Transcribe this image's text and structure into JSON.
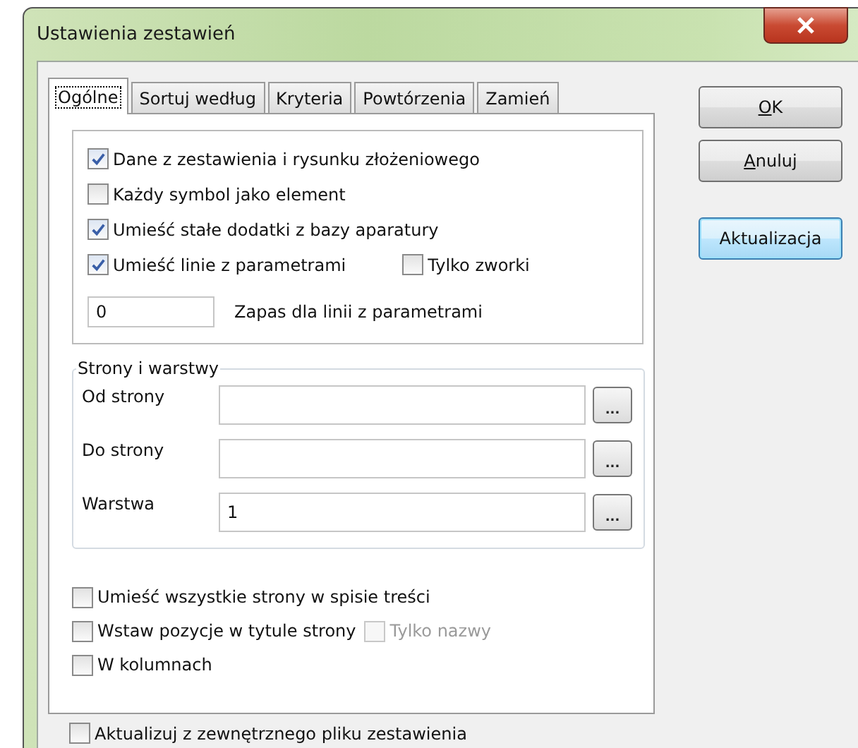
{
  "window": {
    "title": "Ustawienia zestawień"
  },
  "tabs": [
    {
      "label": "Ogólne",
      "selected": true
    },
    {
      "label": "Sortuj według",
      "selected": false
    },
    {
      "label": "Kryteria",
      "selected": false
    },
    {
      "label": "Powtórzenia",
      "selected": false
    },
    {
      "label": "Zamień",
      "selected": false
    }
  ],
  "options": [
    {
      "label": "Dane z zestawienia i rysunku złożeniowego",
      "checked": true
    },
    {
      "label": "Każdy symbol jako element",
      "checked": false
    },
    {
      "label": "Umieść stałe dodatki z bazy aparatury",
      "checked": true
    },
    {
      "label": "Umieść linie z parametrami",
      "checked": true,
      "extra": {
        "label": "Tylko zworki",
        "checked": false,
        "disabled": false
      }
    }
  ],
  "reserve": {
    "value": "0",
    "label": "Zapas dla linii z parametrami"
  },
  "pages_group": {
    "title": "Strony i warstwy",
    "fields": [
      {
        "label": "Od strony",
        "button": "..."
      },
      {
        "label": "Do strony",
        "button": "..."
      },
      {
        "label": "Warstwa",
        "value": "1",
        "button": "..."
      }
    ]
  },
  "page_options": [
    {
      "label": "Umieść wszystkie strony w spisie treści",
      "checked": false
    },
    {
      "label": "Wstaw pozycje w tytule strony",
      "checked": false,
      "extra": {
        "label": "Tylko nazwy",
        "checked": false,
        "disabled": true
      }
    },
    {
      "label": "W kolumnach",
      "checked": false
    }
  ],
  "bottom_option": {
    "label": "Aktualizuj z zewnętrznego pliku zestawienia",
    "checked": false
  },
  "buttons": [
    {
      "label": "OK",
      "mnemonic": true,
      "focused": false
    },
    {
      "label": "Anuluj",
      "mnemonic": true,
      "focused": false
    },
    {
      "label": "Aktualizacja",
      "mnemonic": false,
      "focused": true
    }
  ]
}
